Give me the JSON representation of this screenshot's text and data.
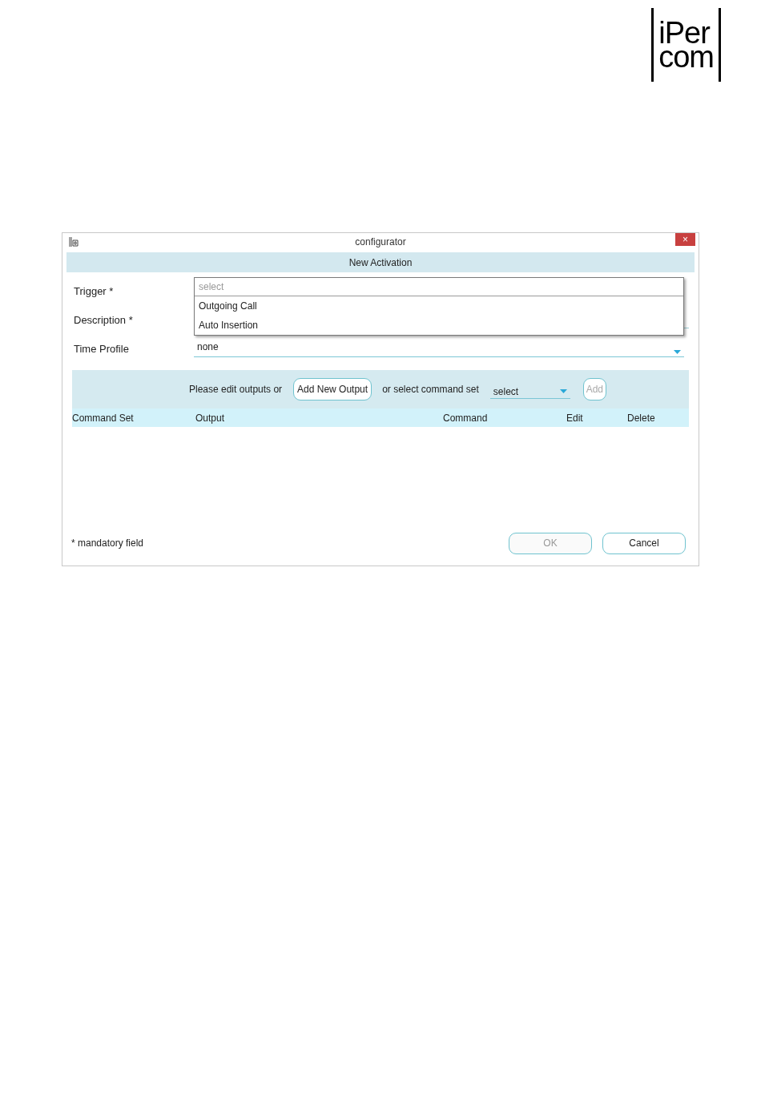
{
  "logo": {
    "line_1": "iPer",
    "line_2": "com"
  },
  "window": {
    "title": "configurator",
    "close": "×"
  },
  "dialog": {
    "title": "New Activation"
  },
  "fields": [
    {
      "label": "Trigger *",
      "kind": "dropdown_open",
      "placeholder": "select",
      "options": [
        "Outgoing Call",
        "Auto Insertion"
      ]
    },
    {
      "label": "Description *",
      "kind": "text"
    },
    {
      "label": "Time Profile",
      "kind": "select",
      "value": "none"
    }
  ],
  "toolbar": {
    "prompt": "Please edit outputs or",
    "add_output": "Add New Output",
    "or_text": "or select command set",
    "command_set": "select",
    "add": "Add",
    "add_disabled": true
  },
  "table": {
    "columns": [
      "Command Set",
      "Output",
      "Command",
      "Edit",
      "Delete"
    ]
  },
  "footer": {
    "note": "* mandatory field",
    "ok": "OK",
    "ok_disabled": true,
    "cancel": "Cancel"
  }
}
